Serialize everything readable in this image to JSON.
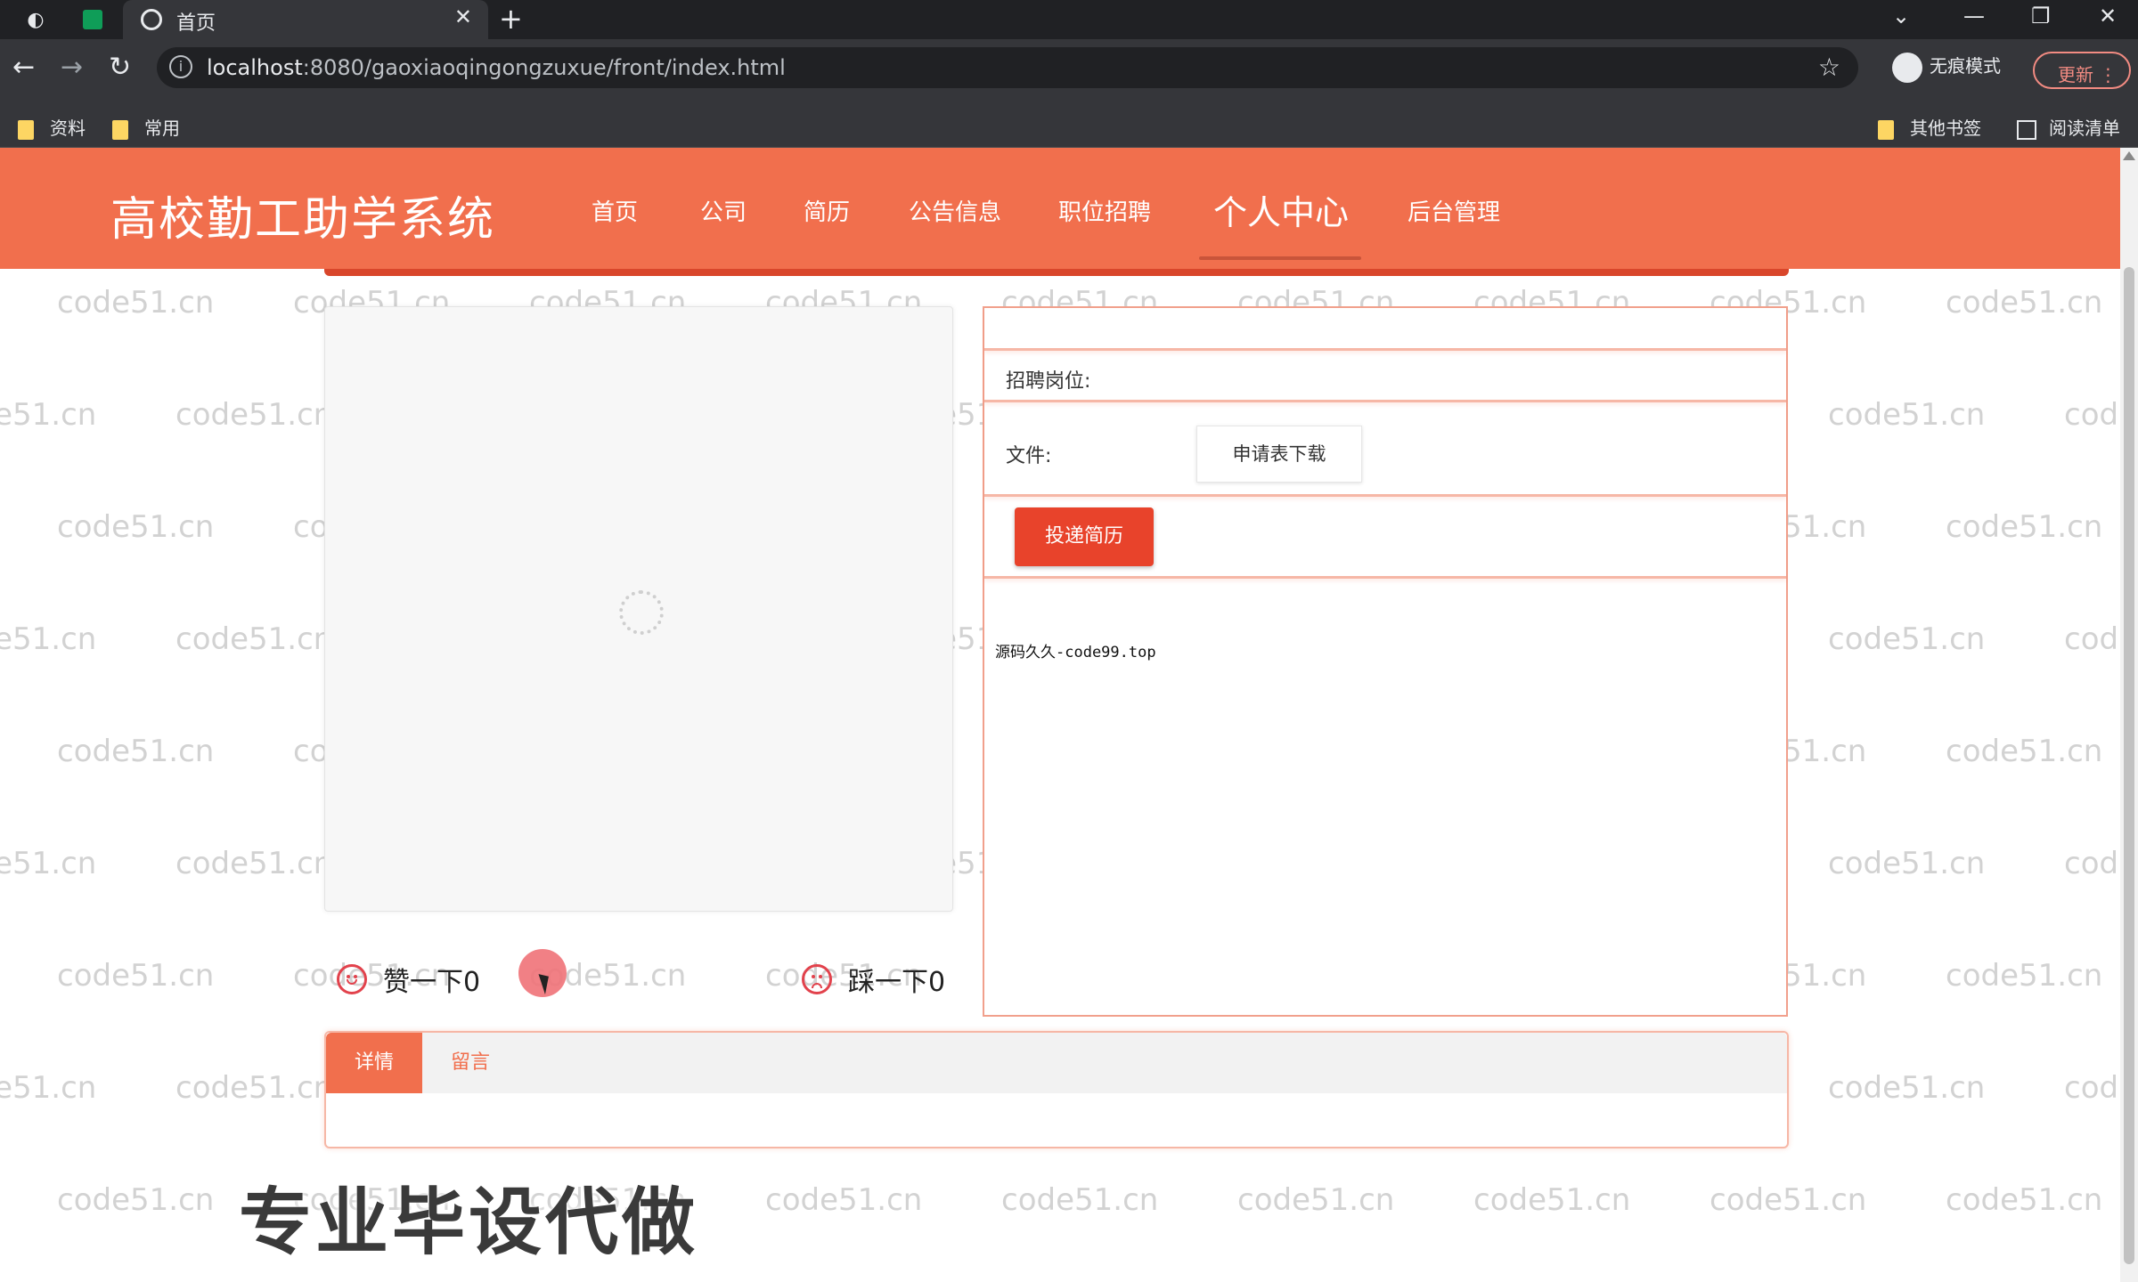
{
  "browser": {
    "tab_title": "首页",
    "url_host": "localhost",
    "url_rest": ":8080/gaoxiaoqingongzuxue/front/index.html",
    "incognito_label": "无痕模式",
    "update_label": "更新",
    "bookmarks": [
      "资料",
      "常用"
    ],
    "bookmarks_right": [
      "其他书签",
      "阅读清单"
    ]
  },
  "header": {
    "site_title": "高校勤工助学系统",
    "nav": [
      "首页",
      "公司",
      "简历",
      "公告信息",
      "职位招聘",
      "个人中心",
      "后台管理"
    ],
    "active_nav": "个人中心"
  },
  "watermark": "code51.cn",
  "votes": {
    "like": "赞一下0",
    "dislike": "踩一下0"
  },
  "info": {
    "position_label": "招聘岗位:",
    "position_value": "",
    "file_label": "文件:",
    "download_label": "申请表下载",
    "apply_label": "投递简历",
    "note": "源码久久-code99.top"
  },
  "tabs": {
    "detail": "详情",
    "comment": "留言"
  },
  "overlay": "专业毕设代做",
  "colors": {
    "brand": "#f16f4d",
    "apply": "#e8432b"
  }
}
